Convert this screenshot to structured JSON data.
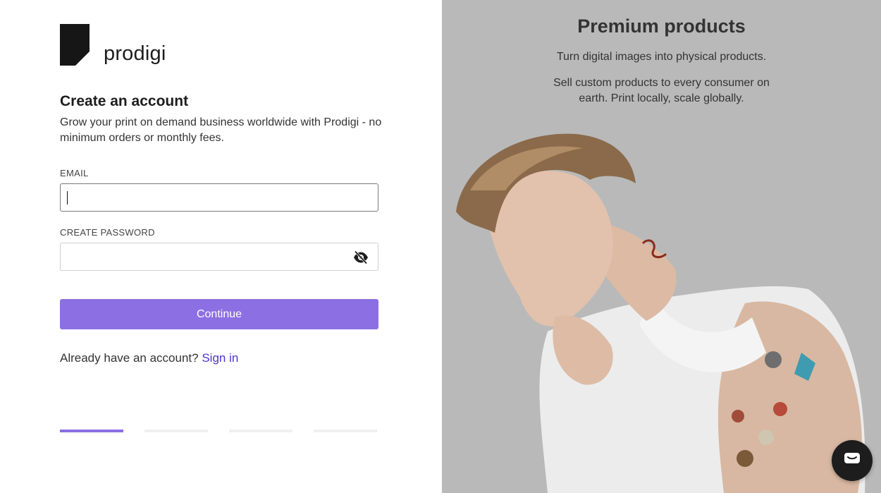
{
  "brand": {
    "name": "prodigi"
  },
  "form": {
    "title": "Create an account",
    "subtitle": "Grow your print on demand business worldwide with Prodigi - no minimum orders or monthly fees.",
    "email_label": "EMAIL",
    "email_value": "",
    "password_label": "CREATE PASSWORD",
    "password_value": "",
    "continue_label": "Continue",
    "signin_prompt": "Already have an account?",
    "signin_link": "Sign in",
    "steps_total": 4,
    "steps_current": 1
  },
  "promo": {
    "title": "Premium products",
    "line1": "Turn digital images into physical products.",
    "line2": "Sell custom products to every consumer on earth. Print locally, scale globally."
  },
  "icons": {
    "password_toggle": "eye-slash-icon",
    "chat": "chat-bubble-icon"
  },
  "colors": {
    "accent": "#8c6fe3",
    "link": "#4a35c9",
    "promo_bg": "#b9b9b9"
  }
}
